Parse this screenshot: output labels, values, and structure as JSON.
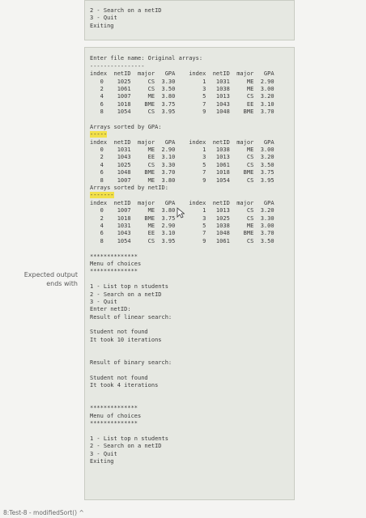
{
  "top_panel_lines": [
    "2 - Search on a netID",
    "3 - Quit",
    "Exiting"
  ],
  "side_label": "Expected output\nends with",
  "footer_label": "8:Test-8 - modifiedSort() ^",
  "output_lines": [
    "",
    "Enter file name: Original arrays:",
    "----------------",
    "index  netID  major   GPA    index  netID  major   GPA",
    "   0    1025     CS  3.30        1   1031     ME  2.90",
    "   2    1061     CS  3.50        3   1038     ME  3.00",
    "   4    1007     ME  3.80        5   1013     CS  3.20",
    "   6    1018    BME  3.75        7   1043     EE  3.10",
    "   8    1054     CS  3.95        9   1048    BME  3.70",
    "",
    "Arrays sorted by GPA:",
    "-----",
    "index  netID  major   GPA    index  netID  major   GPA",
    "   0    1031     ME  2.90        1   1038     ME  3.00",
    "   2    1043     EE  3.10        3   1013     CS  3.20",
    "   4    1025     CS  3.30        5   1061     CS  3.50",
    "   6    1048    BME  3.70        7   1018    BME  3.75",
    "   8    1007     ME  3.80        9   1054     CS  3.95",
    "Arrays sorted by netID:",
    "-------",
    "index  netID  major   GPA    index  netID  major   GPA",
    "   0    1007     ME  3.80        1   1013     CS  3.20",
    "   2    1018    BME  3.75        3   1025     CS  3.30",
    "   4    1031     ME  2.90        5   1038     ME  3.00",
    "   6    1043     EE  3.10        7   1048    BME  3.70",
    "   8    1054     CS  3.95        9   1061     CS  3.50",
    "",
    "**************",
    "Menu of choices",
    "**************",
    "",
    "1 - List top n students",
    "2 - Search on a netID",
    "3 - Quit",
    "Enter netID:",
    "Result of linear search:",
    "",
    "Student not found",
    "It took 10 iterations",
    "",
    "",
    "Result of binary search:",
    "",
    "Student not found",
    "It took 4 iterations",
    "",
    "",
    "**************",
    "Menu of choices",
    "**************",
    "",
    "1 - List top n students",
    "2 - Search on a netID",
    "3 - Quit",
    "Exiting"
  ],
  "colors": {
    "panel_bg": "#e6e8e2",
    "highlight": "#f2e04a",
    "text": "#3a3a3a"
  },
  "icons": [
    "mouse-cursor-icon",
    "chevron-up-icon"
  ]
}
